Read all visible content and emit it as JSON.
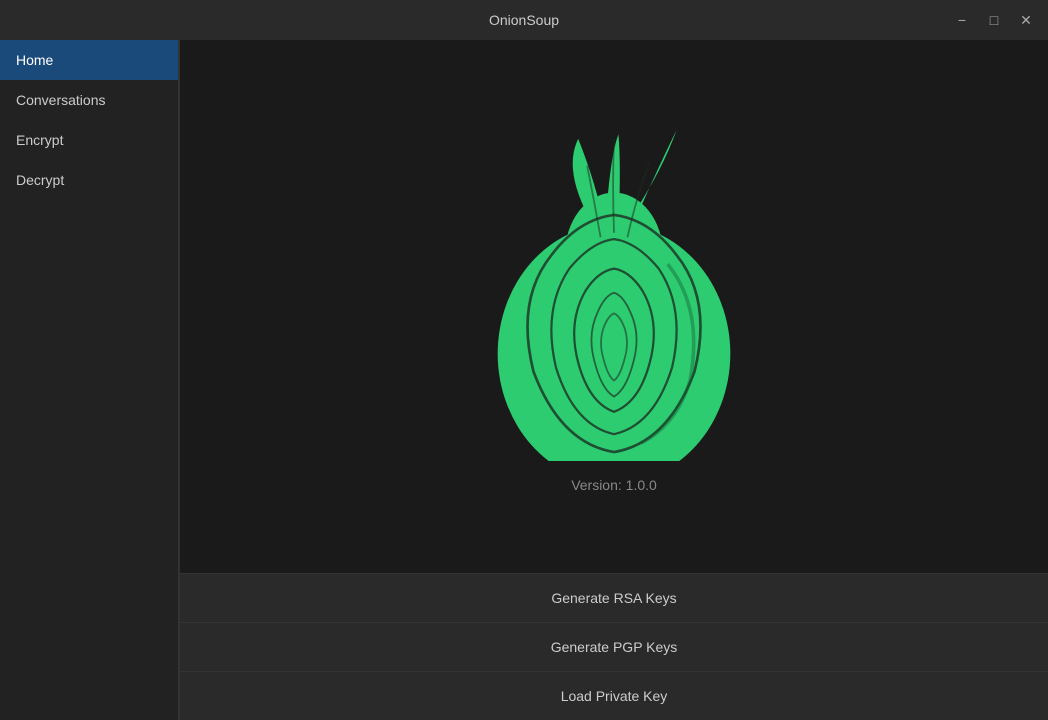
{
  "titlebar": {
    "title": "OnionSoup",
    "minimize_label": "−",
    "maximize_label": "□",
    "close_label": "✕"
  },
  "sidebar": {
    "items": [
      {
        "id": "home",
        "label": "Home",
        "active": true
      },
      {
        "id": "conversations",
        "label": "Conversations",
        "active": false
      },
      {
        "id": "encrypt",
        "label": "Encrypt",
        "active": false
      },
      {
        "id": "decrypt",
        "label": "Decrypt",
        "active": false
      }
    ]
  },
  "content": {
    "version_text": "Version: 1.0.0"
  },
  "buttons": [
    {
      "id": "generate-rsa",
      "label": "Generate RSA Keys"
    },
    {
      "id": "generate-pgp",
      "label": "Generate PGP Keys"
    },
    {
      "id": "load-private-key",
      "label": "Load Private Key"
    }
  ]
}
